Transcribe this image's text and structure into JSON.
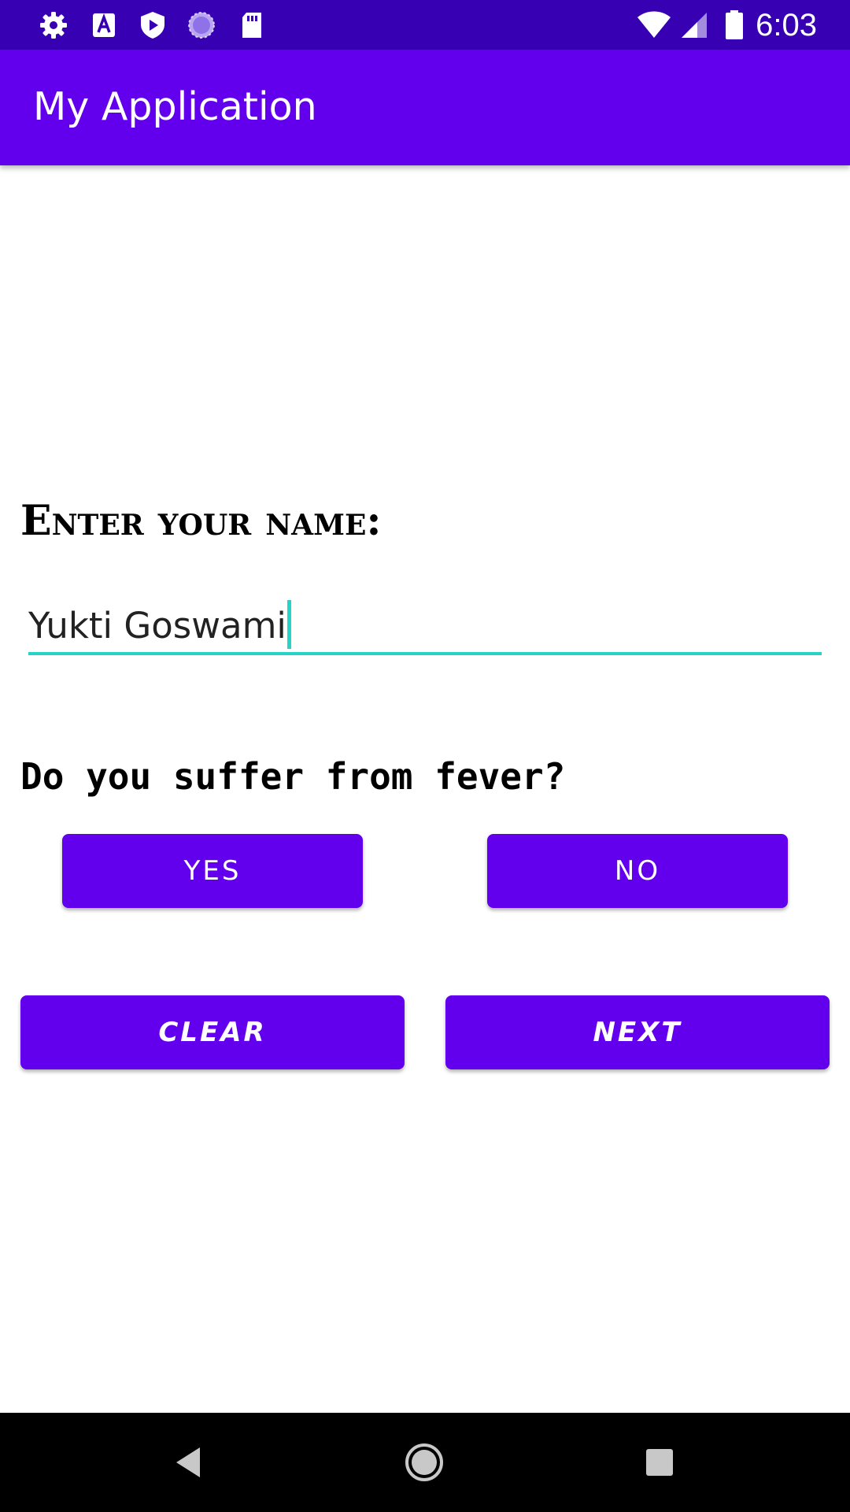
{
  "status_bar": {
    "time": "6:03",
    "left_icons": [
      "settings-icon",
      "accessibility-a-icon",
      "play-protect-icon",
      "loading-circle-icon",
      "sd-card-icon"
    ],
    "right_icons": [
      "wifi-icon",
      "signal-icon",
      "battery-icon"
    ]
  },
  "app_bar": {
    "title": "My Application"
  },
  "form": {
    "name_label": "Enter your name:",
    "name_value": "Yukti Goswami",
    "fever_question": "Do you suffer from fever?",
    "yes_label": "YES",
    "no_label": "NO",
    "clear_label": "CLEAR",
    "next_label": "NEXT"
  },
  "nav_bar": {
    "buttons": [
      "back-icon",
      "home-icon",
      "recents-icon"
    ]
  },
  "colors": {
    "status_bar": "#3700b3",
    "primary": "#6200ee",
    "accent": "#26d3c4",
    "nav_bar": "#000000"
  }
}
